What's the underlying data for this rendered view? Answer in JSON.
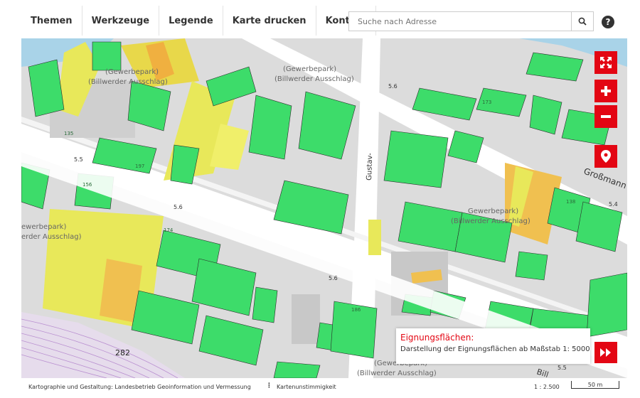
{
  "nav": {
    "items": [
      "Themen",
      "Werkzeuge",
      "Legende",
      "Karte drucken",
      "Kontakt"
    ]
  },
  "search": {
    "placeholder": "Suche nach Adresse"
  },
  "help": {
    "label": "?"
  },
  "map": {
    "labels": {
      "gewerbepark": "(Gewerbepark)",
      "billwerder": "(Billwerder Ausschlag)",
      "gewerbepark_cut": "Gewerbepark)",
      "billwerder_cut": "(Billwerder Ausschlag)",
      "left_gewerbe": "ewerbepark)",
      "left_billwerder": "erder Ausschlag)",
      "gustav": "Gustav-",
      "grossmann": "Großmann",
      "bill": "Bill",
      "elev_56": "5.6",
      "elev_55": "5.5",
      "elev_54": "5.4",
      "num_282": "282",
      "h_135": "135",
      "h_197": "197",
      "h_156": "156",
      "h_174": "174",
      "h_138": "138",
      "h_186": "186",
      "h_173": "173"
    }
  },
  "info_panel": {
    "title": "Eignungsflächen:",
    "text": "Darstellung der Eignungsflächen ab Maßstab 1: 5000"
  },
  "footer": {
    "credit_prefix": "Kartographie und Gestaltung:",
    "credit_link": "Landesbetrieb Geoinformation und Vermessung",
    "separator": "⋮",
    "report": "Kartenunstimmigkeit",
    "scale": "1 : 2.500",
    "scale_bar": "50 m"
  },
  "colors": {
    "accent": "#e30613",
    "green": "#3ddc6a",
    "yellow": "#e8e85a",
    "orange": "#f0b040"
  }
}
